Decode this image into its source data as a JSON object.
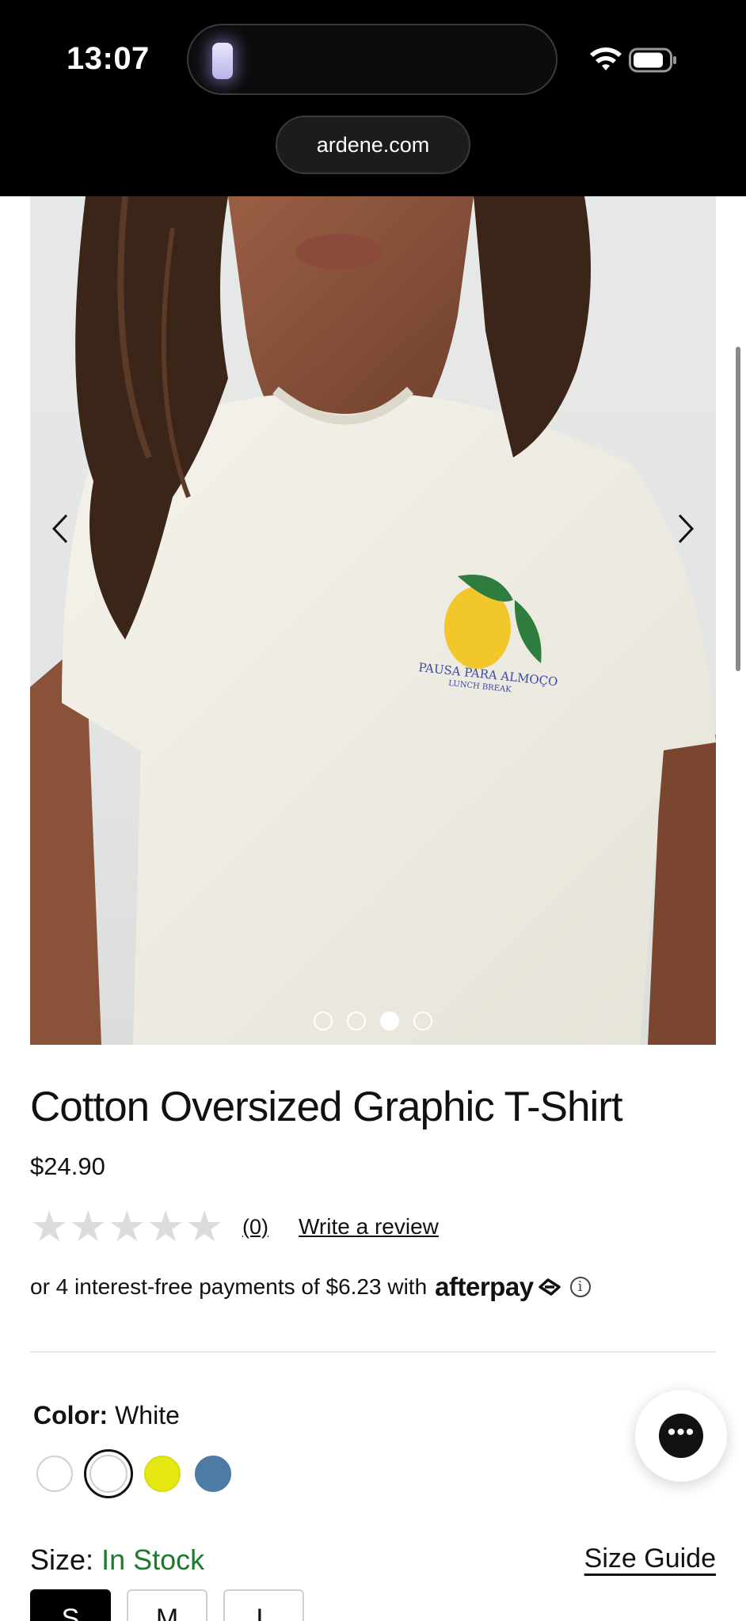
{
  "status_bar": {
    "time": "13:07"
  },
  "browser": {
    "url": "ardene.com"
  },
  "gallery": {
    "print_line1": "PAUSA PARA ALMOÇO",
    "print_line2": "LUNCH BREAK",
    "slide_count": 4,
    "active_slide": 3
  },
  "product": {
    "title": "Cotton Oversized Graphic T-Shirt",
    "price": "$24.90",
    "rating_stars": 0,
    "review_count": "(0)",
    "write_review_label": "Write a review",
    "afterpay_text": "or 4 interest-free payments of $6.23 with",
    "afterpay_brand": "afterpay",
    "info_icon": "ⓘ"
  },
  "color": {
    "label": "Color:",
    "value": "White",
    "swatches": [
      "#ffffff",
      "#ffffff",
      "#e5e813",
      "#4e7ba3"
    ],
    "selected_index": 1
  },
  "size": {
    "label": "Size:",
    "stock": "In Stock",
    "guide_label": "Size Guide",
    "options": [
      "S",
      "M",
      "L"
    ],
    "selected": "S"
  },
  "chat": {
    "icon": "chat-icon"
  },
  "colors": {
    "in_stock": "#1f7a2e",
    "topbar": "#000000"
  }
}
